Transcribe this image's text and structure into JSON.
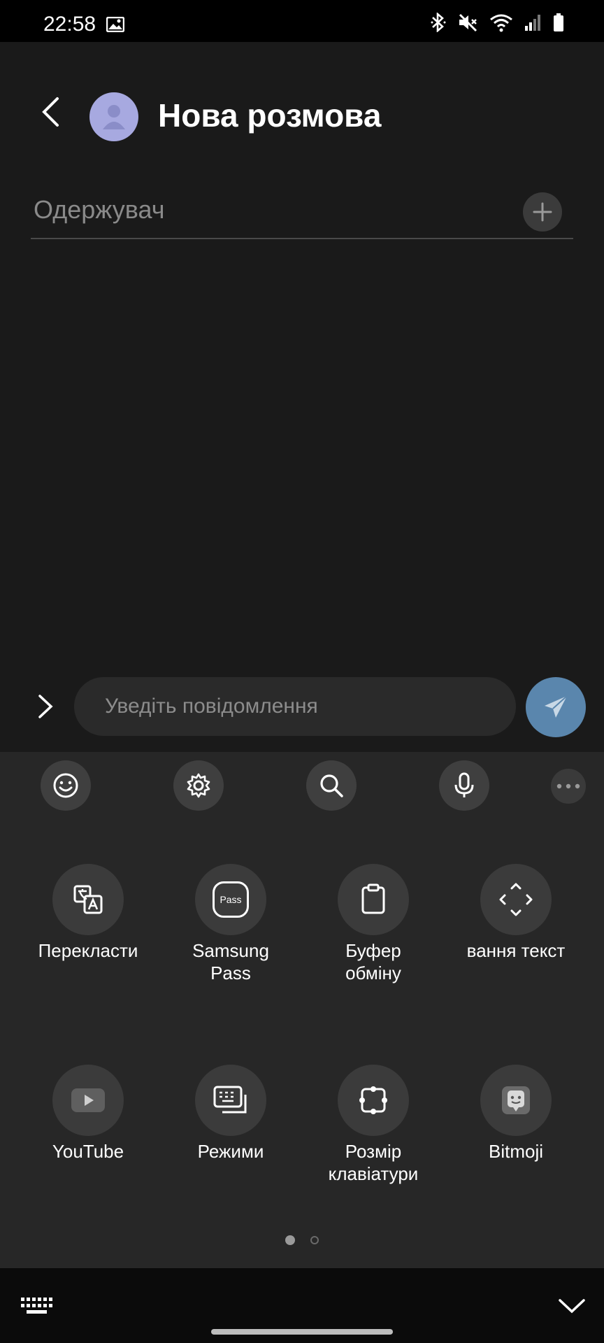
{
  "status_bar": {
    "time": "22:58",
    "icons": [
      "gallery-icon",
      "bluetooth-icon",
      "mute-icon",
      "wifi-icon",
      "signal-icon",
      "battery-icon"
    ]
  },
  "header": {
    "title": "Нова розмова"
  },
  "recipient": {
    "placeholder": "Одержувач"
  },
  "composer": {
    "placeholder": "Уведіть повідомлення"
  },
  "keyboard_toolbar": {
    "icons": [
      "emoji-icon",
      "settings-icon",
      "search-icon",
      "microphone-icon",
      "more-icon"
    ]
  },
  "keyboard_grid": {
    "items": [
      {
        "label": "Перекласти"
      },
      {
        "label": "Samsung\nPass"
      },
      {
        "label": "Буфер\nобміну"
      },
      {
        "label": "вання текст"
      },
      {
        "label": "YouTube"
      },
      {
        "label": "Режими"
      },
      {
        "label": "Розмір\nклавіатури"
      },
      {
        "label": "Bitmoji"
      }
    ],
    "pass_badge": "Pass"
  },
  "pagination": {
    "current": 1,
    "total": 2
  },
  "colors": {
    "background": "#1a1a1a",
    "keyboard": "#272727",
    "send_button": "#5a86ad",
    "avatar": "#a7a9e0"
  }
}
